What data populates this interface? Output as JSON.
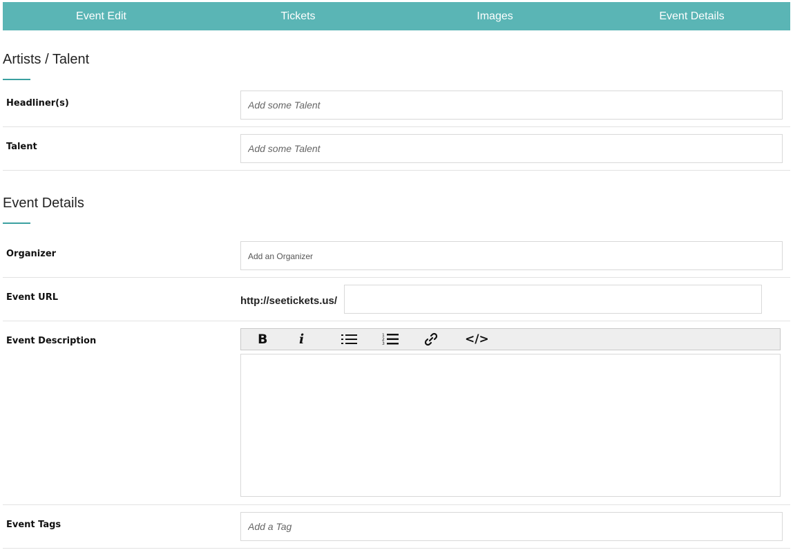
{
  "tabs": [
    {
      "label": "Event Edit"
    },
    {
      "label": "Tickets"
    },
    {
      "label": "Images"
    },
    {
      "label": "Event Details"
    }
  ],
  "artists_section": {
    "title": "Artists / Talent",
    "headliners": {
      "label": "Headliner(s)",
      "placeholder": "Add some Talent",
      "value": ""
    },
    "talent": {
      "label": "Talent",
      "placeholder": "Add some Talent",
      "value": ""
    }
  },
  "event_details_section": {
    "title": "Event Details",
    "organizer": {
      "label": "Organizer",
      "placeholder": "Add an Organizer",
      "value": ""
    },
    "event_url": {
      "label": "Event URL",
      "prefix": "http://seetickets.us/",
      "value": ""
    },
    "event_description": {
      "label": "Event Description",
      "toolbar": {
        "bold": "B",
        "italic": "i",
        "code": "</>",
        "icons": [
          "bold-icon",
          "italic-icon",
          "bullet-list-icon",
          "numbered-list-icon",
          "link-icon",
          "code-icon"
        ]
      },
      "value": ""
    },
    "event_tags": {
      "label": "Event Tags",
      "placeholder": "Add a Tag",
      "value": ""
    }
  },
  "colors": {
    "tab_bar": "#5ab5b5",
    "accent_underline": "#3aa0a0"
  }
}
